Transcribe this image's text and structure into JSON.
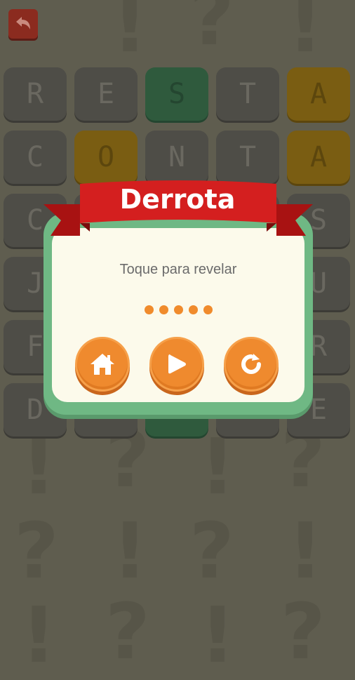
{
  "header": {
    "back_icon": "back-arrow-icon"
  },
  "board": {
    "rows": [
      [
        {
          "letter": "R",
          "state": "empty"
        },
        {
          "letter": "E",
          "state": "empty"
        },
        {
          "letter": "S",
          "state": "correct"
        },
        {
          "letter": "T",
          "state": "empty"
        },
        {
          "letter": "A",
          "state": "present"
        }
      ],
      [
        {
          "letter": "C",
          "state": "empty"
        },
        {
          "letter": "O",
          "state": "present"
        },
        {
          "letter": "N",
          "state": "empty"
        },
        {
          "letter": "T",
          "state": "empty"
        },
        {
          "letter": "A",
          "state": "present"
        }
      ],
      [
        {
          "letter": "C",
          "state": "empty"
        },
        {
          "letter": "",
          "state": "empty"
        },
        {
          "letter": "",
          "state": "empty"
        },
        {
          "letter": "",
          "state": "empty"
        },
        {
          "letter": "S",
          "state": "empty"
        }
      ],
      [
        {
          "letter": "J",
          "state": "empty"
        },
        {
          "letter": "",
          "state": "empty"
        },
        {
          "letter": "",
          "state": "empty"
        },
        {
          "letter": "",
          "state": "empty"
        },
        {
          "letter": "U",
          "state": "empty"
        }
      ],
      [
        {
          "letter": "F",
          "state": "empty"
        },
        {
          "letter": "",
          "state": "empty"
        },
        {
          "letter": "",
          "state": "empty"
        },
        {
          "letter": "",
          "state": "empty"
        },
        {
          "letter": "R",
          "state": "empty"
        }
      ],
      [
        {
          "letter": "D",
          "state": "empty"
        },
        {
          "letter": "",
          "state": "empty"
        },
        {
          "letter": "",
          "state": "correct"
        },
        {
          "letter": "",
          "state": "empty"
        },
        {
          "letter": "E",
          "state": "empty"
        }
      ]
    ]
  },
  "dialog": {
    "title": "Derrota",
    "subtitle": "Toque para revelar",
    "hidden_letters": 5,
    "buttons": [
      {
        "name": "home-button",
        "icon": "home-icon"
      },
      {
        "name": "play-button",
        "icon": "play-icon"
      },
      {
        "name": "restart-button",
        "icon": "restart-icon"
      }
    ]
  },
  "colors": {
    "correct": "#2f5a3d",
    "present": "#7a5d12",
    "ribbon": "#d41f1f",
    "button": "#ef8a2e"
  }
}
